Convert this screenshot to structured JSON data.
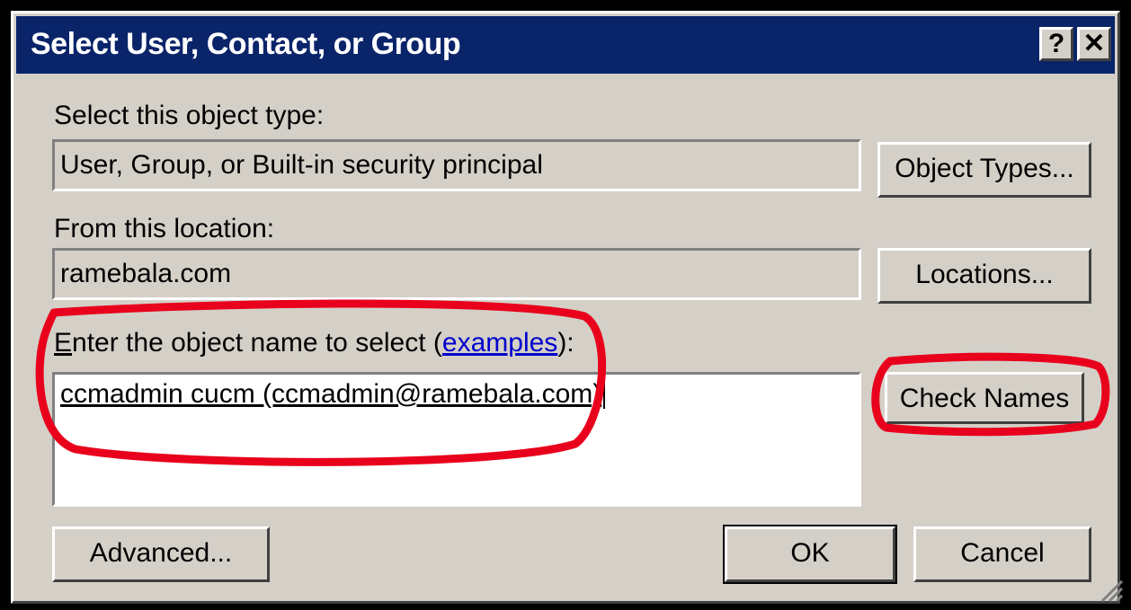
{
  "window": {
    "title": "Select User, Contact, or Group",
    "help_glyph": "?",
    "close_glyph": "✕"
  },
  "object_type": {
    "label": "Select this object type:",
    "value": "User, Group, or Built-in security principal",
    "button_label": "Object Types..."
  },
  "location": {
    "label": "From this location:",
    "value": "ramebala.com",
    "button_label": "Locations..."
  },
  "object_name": {
    "label_prefix_accel": "E",
    "label_prefix_rest": "nter the object name to select (",
    "link_text": "examples",
    "label_suffix": "):",
    "value": "ccmadmin cucm (ccmadmin@ramebala.com)",
    "button_label": "Check Names"
  },
  "footer": {
    "advanced_label": "Advanced...",
    "ok_label": "OK",
    "cancel_label": "Cancel"
  },
  "annotation_color": "#e8001c"
}
